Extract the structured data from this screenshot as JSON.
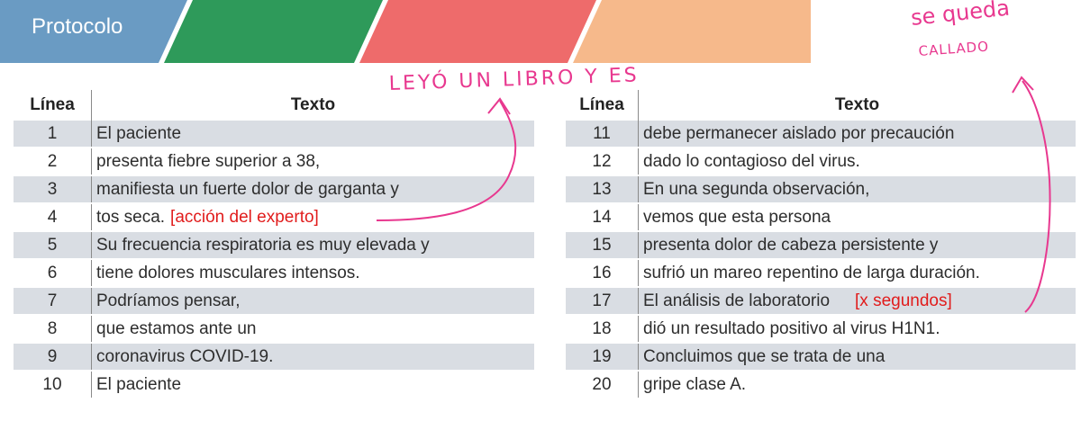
{
  "process_steps": [
    {
      "label": "Protocolo",
      "color": "#6a9bc3"
    },
    {
      "label": "",
      "color": "#2e9a5a"
    },
    {
      "label": "",
      "color": "#ee6b6b"
    },
    {
      "label": "",
      "color": "#f6b98b"
    }
  ],
  "table_headers": {
    "line": "Línea",
    "text": "Texto"
  },
  "rows_left": [
    {
      "line": "1",
      "text": "El paciente"
    },
    {
      "line": "2",
      "text": "presenta fiebre superior a 38,"
    },
    {
      "line": "3",
      "text": "manifiesta un fuerte dolor de garganta y"
    },
    {
      "line": "4",
      "text": "tos seca.",
      "note": "[acción del experto]"
    },
    {
      "line": "5",
      "text": "Su frecuencia respiratoria es muy elevada y"
    },
    {
      "line": "6",
      "text": "tiene dolores musculares intensos."
    },
    {
      "line": "7",
      "text": "Podríamos pensar,"
    },
    {
      "line": "8",
      "text": "que estamos ante un"
    },
    {
      "line": "9",
      "text": "coronavirus COVID-19."
    },
    {
      "line": "10",
      "text": "El paciente"
    }
  ],
  "rows_right": [
    {
      "line": "11",
      "text": "debe permanecer aislado por precaución"
    },
    {
      "line": "12",
      "text": "dado lo contagioso del virus."
    },
    {
      "line": "13",
      "text": "En una segunda observación,"
    },
    {
      "line": "14",
      "text": "vemos que esta persona"
    },
    {
      "line": "15",
      "text": "presenta dolor de cabeza persistente y"
    },
    {
      "line": "16",
      "text": "sufrió un mareo repentino de larga duración."
    },
    {
      "line": "17",
      "text": "El análisis de laboratorio",
      "note": "[x segundos]"
    },
    {
      "line": "18",
      "text": "dió un resultado positivo al virus H1N1."
    },
    {
      "line": "19",
      "text": "Concluimos que se trata de una"
    },
    {
      "line": "20",
      "text": "gripe clase A."
    }
  ],
  "handwritten": {
    "annotation_1": "LEYÓ UN LIBRO Y ES",
    "annotation_2_line1": "se queda",
    "annotation_2_line2": "CALLADO"
  },
  "colors": {
    "annotation": "#e8388f",
    "note": "#e11c1c",
    "row_shade": "#d9dde3"
  }
}
